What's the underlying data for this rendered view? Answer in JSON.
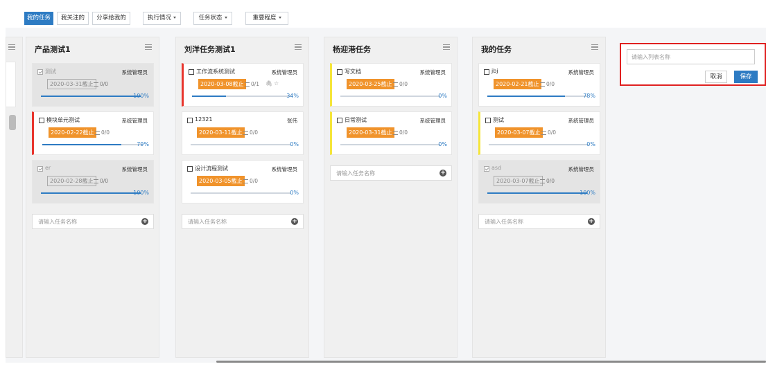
{
  "toolbar": {
    "tabs": [
      {
        "label": "我的任务",
        "active": true
      },
      {
        "label": "我关注的",
        "active": false
      },
      {
        "label": "分享给我的",
        "active": false
      }
    ],
    "filters": [
      "执行情况",
      "任务状态",
      "重要程度"
    ]
  },
  "columns": [
    {
      "title": "产品测试1",
      "cards": [
        {
          "name": "测试",
          "assignee": "系统管理员",
          "due": "2020-03-31截止",
          "subtasks": "0/0",
          "progress": 100,
          "progress_label": "100%",
          "done": true,
          "due_style": "grey",
          "flag": "none"
        },
        {
          "name": "模块单元测试",
          "assignee": "系统管理员",
          "due": "2020-02-22截止",
          "subtasks": "0/0",
          "progress": 79,
          "progress_label": "79%",
          "done": false,
          "due_style": "orange",
          "flag": "red"
        },
        {
          "name": "er",
          "assignee": "系统管理员",
          "due": "2020-02-28截止",
          "subtasks": "0/0",
          "progress": 100,
          "progress_label": "100%",
          "done": true,
          "due_style": "grey",
          "flag": "none"
        }
      ],
      "add_placeholder": "请输入任务名称"
    },
    {
      "title": "刘洋任务测试1",
      "cards": [
        {
          "name": "工作流系统测试",
          "assignee": "系统管理员",
          "due": "2020-03-08截止",
          "subtasks": "0/1",
          "progress": 34,
          "progress_label": "34%",
          "done": false,
          "due_style": "orange",
          "flag": "red",
          "extras": true
        },
        {
          "name": "12321",
          "assignee": "张伟",
          "due": "2020-03-11截止",
          "subtasks": "0/0",
          "progress": 0,
          "progress_label": "0%",
          "done": false,
          "due_style": "orange",
          "flag": "none"
        },
        {
          "name": "设计流程测试",
          "assignee": "系统管理员",
          "due": "2020-03-05截止",
          "subtasks": "0/0",
          "progress": 0,
          "progress_label": "0%",
          "done": false,
          "due_style": "orange",
          "flag": "none"
        }
      ],
      "add_placeholder": "请输入任务名称"
    },
    {
      "title": "杨迎港任务",
      "cards": [
        {
          "name": "写文档",
          "assignee": "系统管理员",
          "due": "2020-03-25截止",
          "subtasks": "0/0",
          "progress": 0,
          "progress_label": "0%",
          "done": false,
          "due_style": "orange",
          "flag": "yellow"
        },
        {
          "name": "日常测试",
          "assignee": "系统管理员",
          "due": "2020-03-31截止",
          "subtasks": "0/0",
          "progress": 0,
          "progress_label": "0%",
          "done": false,
          "due_style": "orange",
          "flag": "yellow"
        }
      ],
      "add_placeholder": "请输入任务名称"
    },
    {
      "title": "我的任务",
      "cards": [
        {
          "name": "jbj",
          "assignee": "系统管理员",
          "due": "2020-02-21截止",
          "subtasks": "0/0",
          "progress": 78,
          "progress_label": "78%",
          "done": false,
          "due_style": "orange",
          "flag": "none"
        },
        {
          "name": "测试",
          "assignee": "系统管理员",
          "due": "2020-03-07截止",
          "subtasks": "0/0",
          "progress": 0,
          "progress_label": "0%",
          "done": false,
          "due_style": "orange",
          "flag": "yellow"
        },
        {
          "name": "asd",
          "assignee": "系统管理员",
          "due": "2020-03-07截止",
          "subtasks": "0/0",
          "progress": 100,
          "progress_label": "100%",
          "done": true,
          "due_style": "grey",
          "flag": "none"
        }
      ],
      "add_placeholder": "请输入任务名称"
    }
  ],
  "new_list": {
    "placeholder": "请输入列表名称",
    "cancel_label": "取消",
    "save_label": "保存"
  },
  "colors": {
    "accent": "#2d7bc3",
    "due_orange": "#f0932b",
    "flag_red": "#e8352d",
    "flag_yellow": "#f5e53a",
    "highlight_border": "#e02020"
  }
}
